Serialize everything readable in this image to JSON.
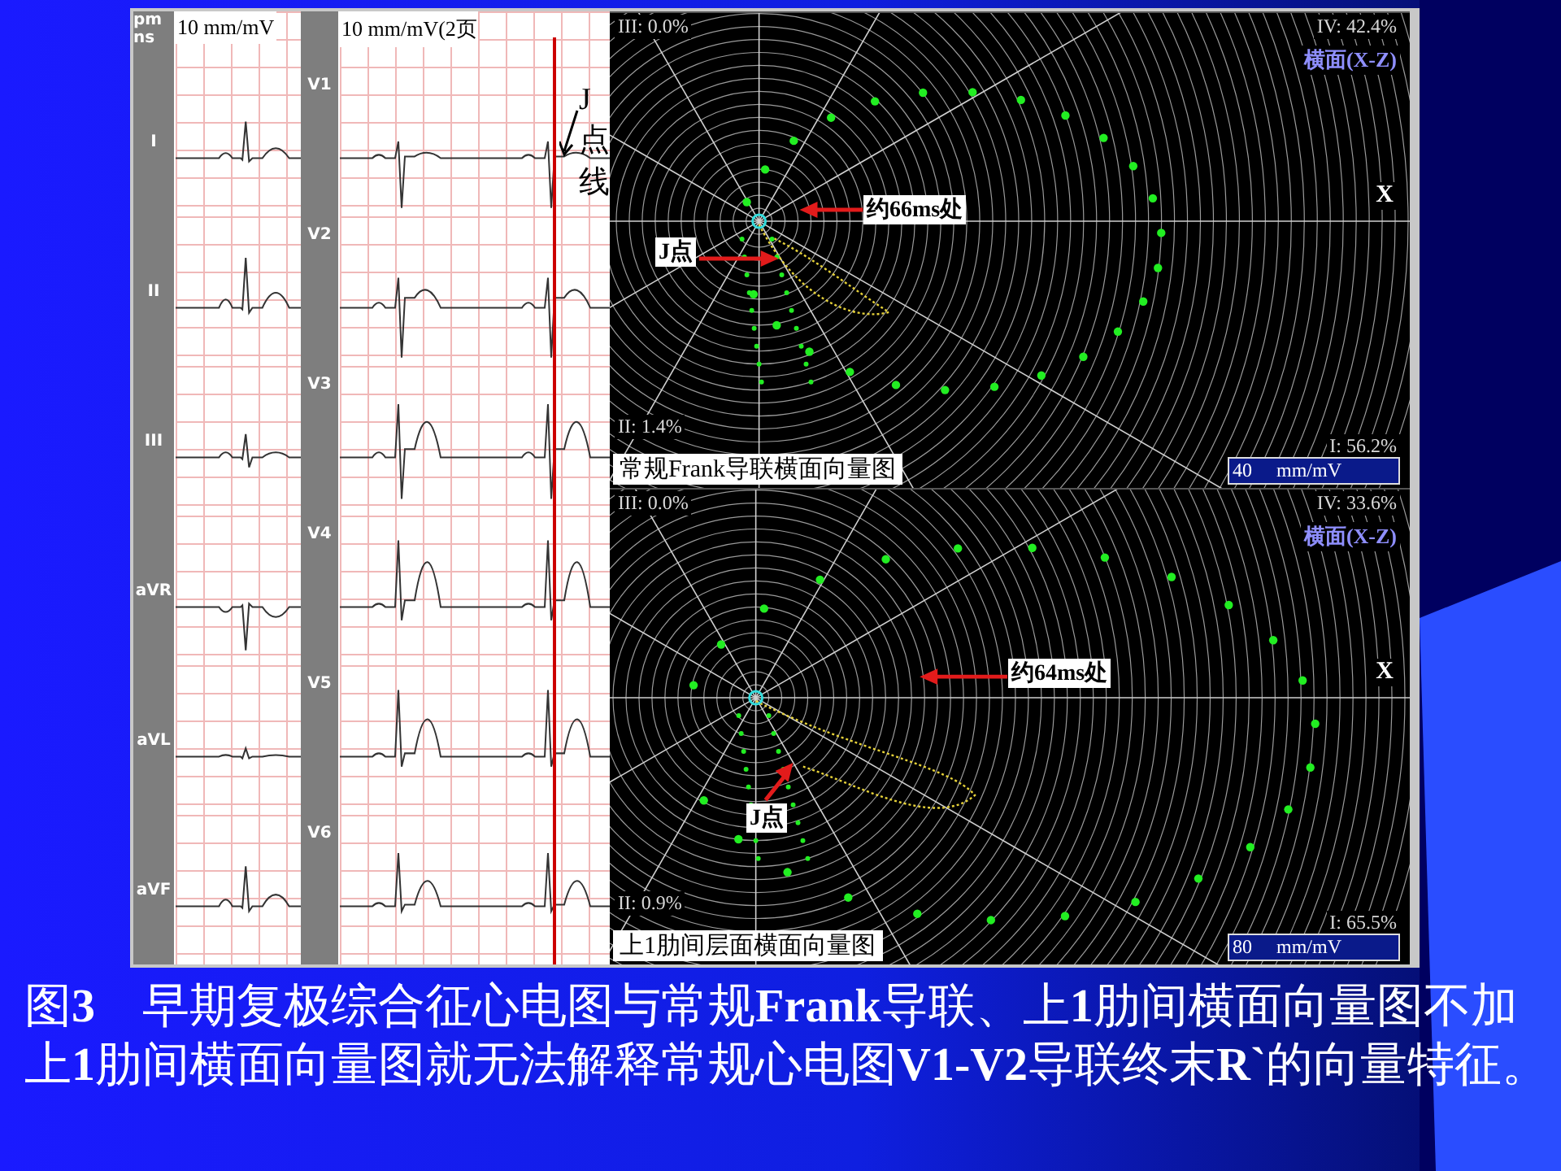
{
  "figure": {
    "ecg": {
      "header_lines": [
        "pm",
        "ns"
      ],
      "scale_limb": "10 mm/mV",
      "scale_chest": "10 mm/mV(2页",
      "limb_leads": [
        "I",
        "II",
        "III",
        "aVR",
        "aVL",
        "aVF"
      ],
      "chest_leads": [
        "V1",
        "V2",
        "V3",
        "V4",
        "V5",
        "V6"
      ],
      "j_line_label": "J点线"
    },
    "vector_plots": [
      {
        "quadrant_iii": "III: 0.0%",
        "quadrant_iv": "IV: 42.4%",
        "plane": "横面(X-Z)",
        "axis": "X",
        "time_label": "约66ms处",
        "j_label": "J点",
        "quadrant_ii": "II: 1.4%",
        "quadrant_i": "I: 56.2%",
        "title": "常规Frank导联横面向量图",
        "scale": "40     mm/mV"
      },
      {
        "quadrant_iii": "III: 0.0%",
        "quadrant_iv": "IV: 33.6%",
        "plane": "横面(X-Z)",
        "axis": "X",
        "time_label": "约64ms处",
        "j_label": "J点",
        "quadrant_ii": "II: 0.9%",
        "quadrant_i": "I: 65.5%",
        "title": "上1肋间层面横面向量图",
        "scale": "80     mm/mV"
      }
    ]
  },
  "caption": "图**3**　早期复极综合征心电图与常规**Frank**导联、上**1**肋间横面向量图不加上**1**肋间横面向量图就无法解释常规心电图**V1-V2**导联终末**R`**的向量特征。"
}
